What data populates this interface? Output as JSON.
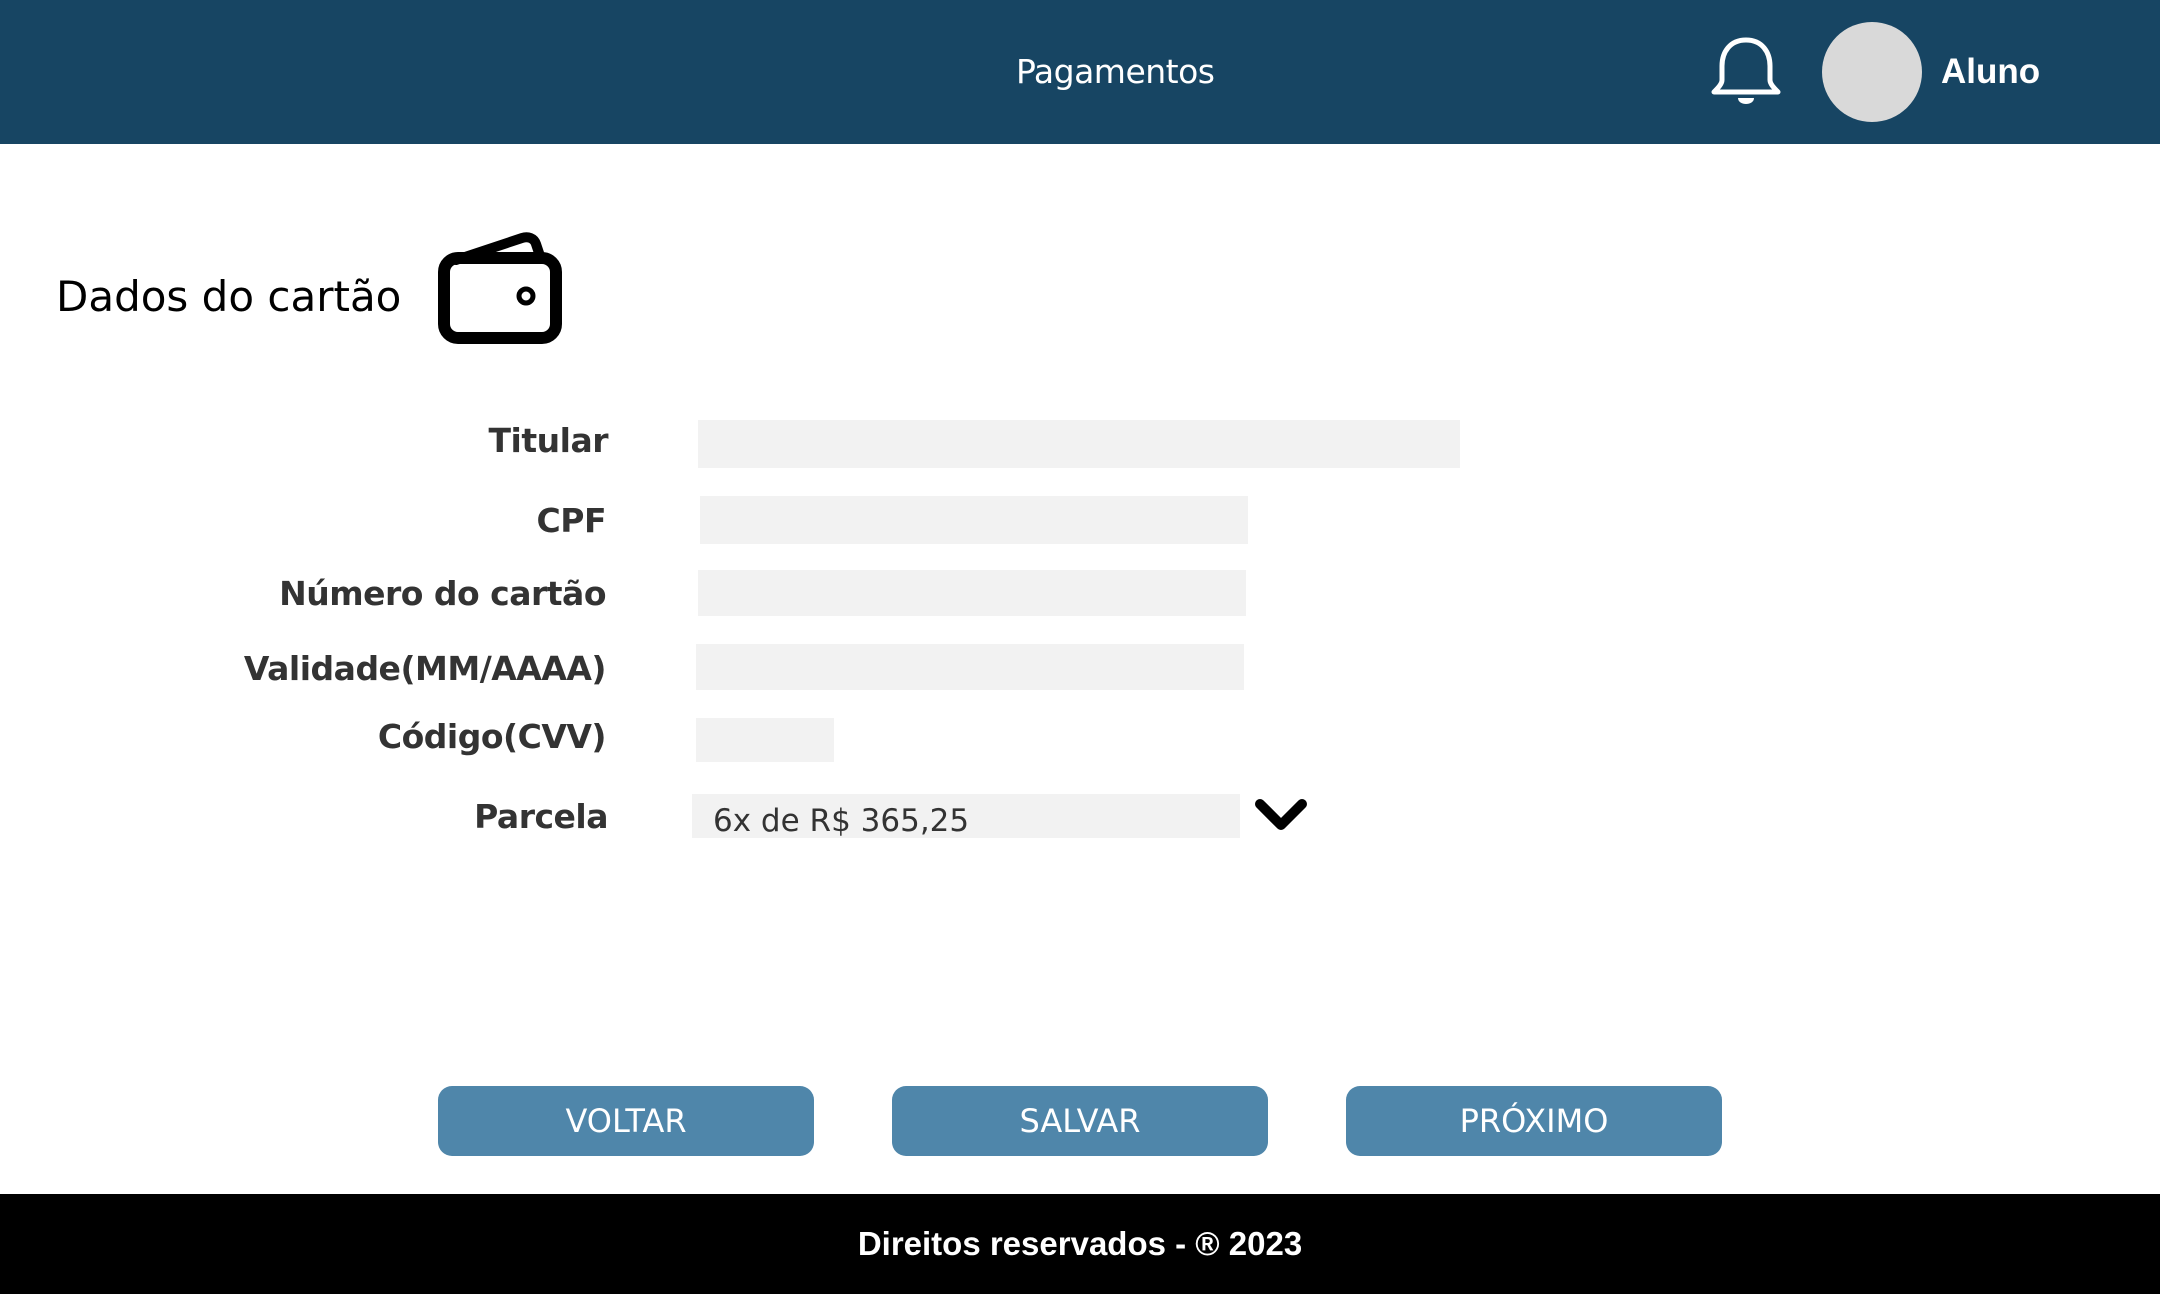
{
  "header": {
    "title": "Pagamentos",
    "user_name": "Aluno",
    "bell_icon": "bell-icon",
    "avatar_color": "#d9d9d9",
    "background_color": "#174563"
  },
  "section": {
    "title": "Dados do cartão",
    "icon": "wallet-icon"
  },
  "form": {
    "titular_label": "Titular",
    "titular_value": "",
    "cpf_label": "CPF",
    "cpf_value": "",
    "numero_label": "Número do cartão",
    "numero_value": "",
    "validade_label": "Validade(MM/AAAA)",
    "validade_value": "",
    "codigo_label": "Código(CVV)",
    "codigo_value": "",
    "parcela_label": "Parcela",
    "parcela_selected": "6x de R$ 365,25",
    "parcela_icon": "chevron-down-icon"
  },
  "buttons": {
    "back": "VOLTAR",
    "save": "SALVAR",
    "next": "PRÓXIMO",
    "color": "#4f86aa"
  },
  "footer": {
    "text": "Direitos reservados - ® 2023"
  }
}
